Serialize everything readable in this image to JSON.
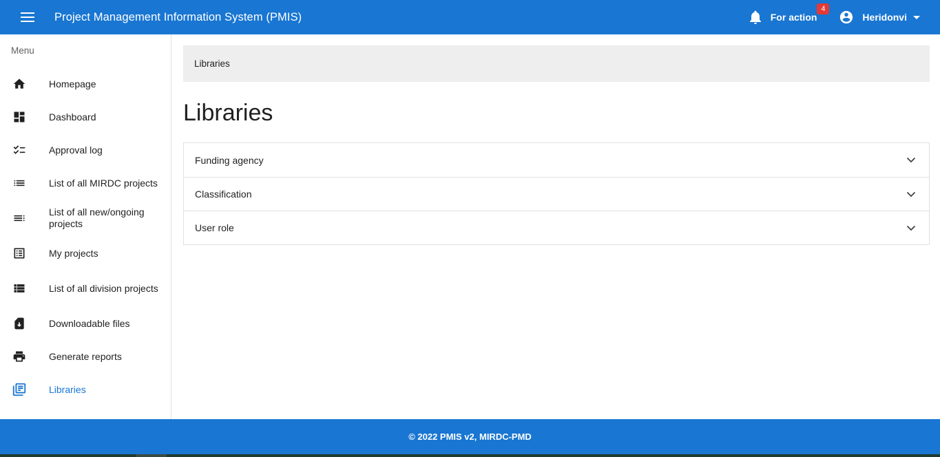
{
  "header": {
    "title": "Project Management Information System (PMIS)",
    "for_action_label": "For action",
    "for_action_count": "4",
    "user_name": "Heridonvi"
  },
  "sidebar": {
    "menu_label": "Menu",
    "items": [
      {
        "label": "Homepage",
        "icon": "home-icon"
      },
      {
        "label": "Dashboard",
        "icon": "dashboard-icon"
      },
      {
        "label": "Approval log",
        "icon": "checklist-icon"
      },
      {
        "label": "List of all MIRDC projects",
        "icon": "list-icon"
      },
      {
        "label": "List of all new/ongoing projects",
        "icon": "list-ongoing-icon"
      },
      {
        "label": "My projects",
        "icon": "document-list-icon"
      },
      {
        "label": "List of all division projects",
        "icon": "view-list-icon"
      },
      {
        "label": "Downloadable files",
        "icon": "download-file-icon"
      },
      {
        "label": "Generate reports",
        "icon": "printer-icon"
      },
      {
        "label": "Libraries",
        "icon": "library-books-icon",
        "active": true
      }
    ]
  },
  "main": {
    "breadcrumb": "Libraries",
    "title": "Libraries",
    "sections": [
      {
        "label": "Funding agency"
      },
      {
        "label": "Classification"
      },
      {
        "label": "User role"
      }
    ]
  },
  "footer": {
    "text": "© 2022 PMIS v2, MIRDC-PMD"
  },
  "colors": {
    "primary": "#1976d2",
    "badge": "#e53935",
    "breadcrumb_bg": "#eeeeee"
  }
}
